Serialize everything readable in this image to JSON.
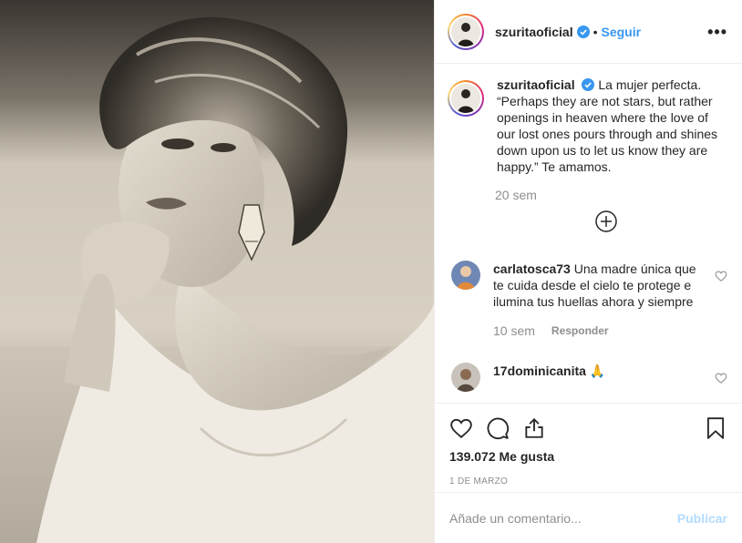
{
  "header": {
    "username": "szuritaoficial",
    "separator": "•",
    "follow_label": "Seguir",
    "more_label": "•••"
  },
  "caption": {
    "username": "szuritaoficial",
    "text": "La mujer perfecta. “Perhaps they are not stars, but rather openings in heaven where the love of our lost ones pours through and shines down upon us to let us know they are happy.” Te amamos.",
    "time": "20 sem"
  },
  "comments": [
    {
      "username": "carlatosca73",
      "text": "Una madre única que te cuida desde el cielo te protege e ilumina tus huellas ahora y siempre",
      "time": "10 sem",
      "reply_label": "Responder"
    },
    {
      "username": "17dominicanita",
      "text": "🙏"
    }
  ],
  "actions": {
    "likes": "139.072 Me gusta",
    "date": "1 DE MARZO"
  },
  "add_comment": {
    "placeholder": "Añade un comentario...",
    "publish_label": "Publicar"
  },
  "colors": {
    "accent": "#3897f0",
    "publish_disabled": "#b3dbff",
    "muted": "#8e8e8e"
  },
  "icons": [
    "verified-icon",
    "more-icon",
    "plus-circle-icon",
    "heart-icon",
    "comment-icon",
    "share-icon",
    "bookmark-icon",
    "heart-small-icon"
  ]
}
